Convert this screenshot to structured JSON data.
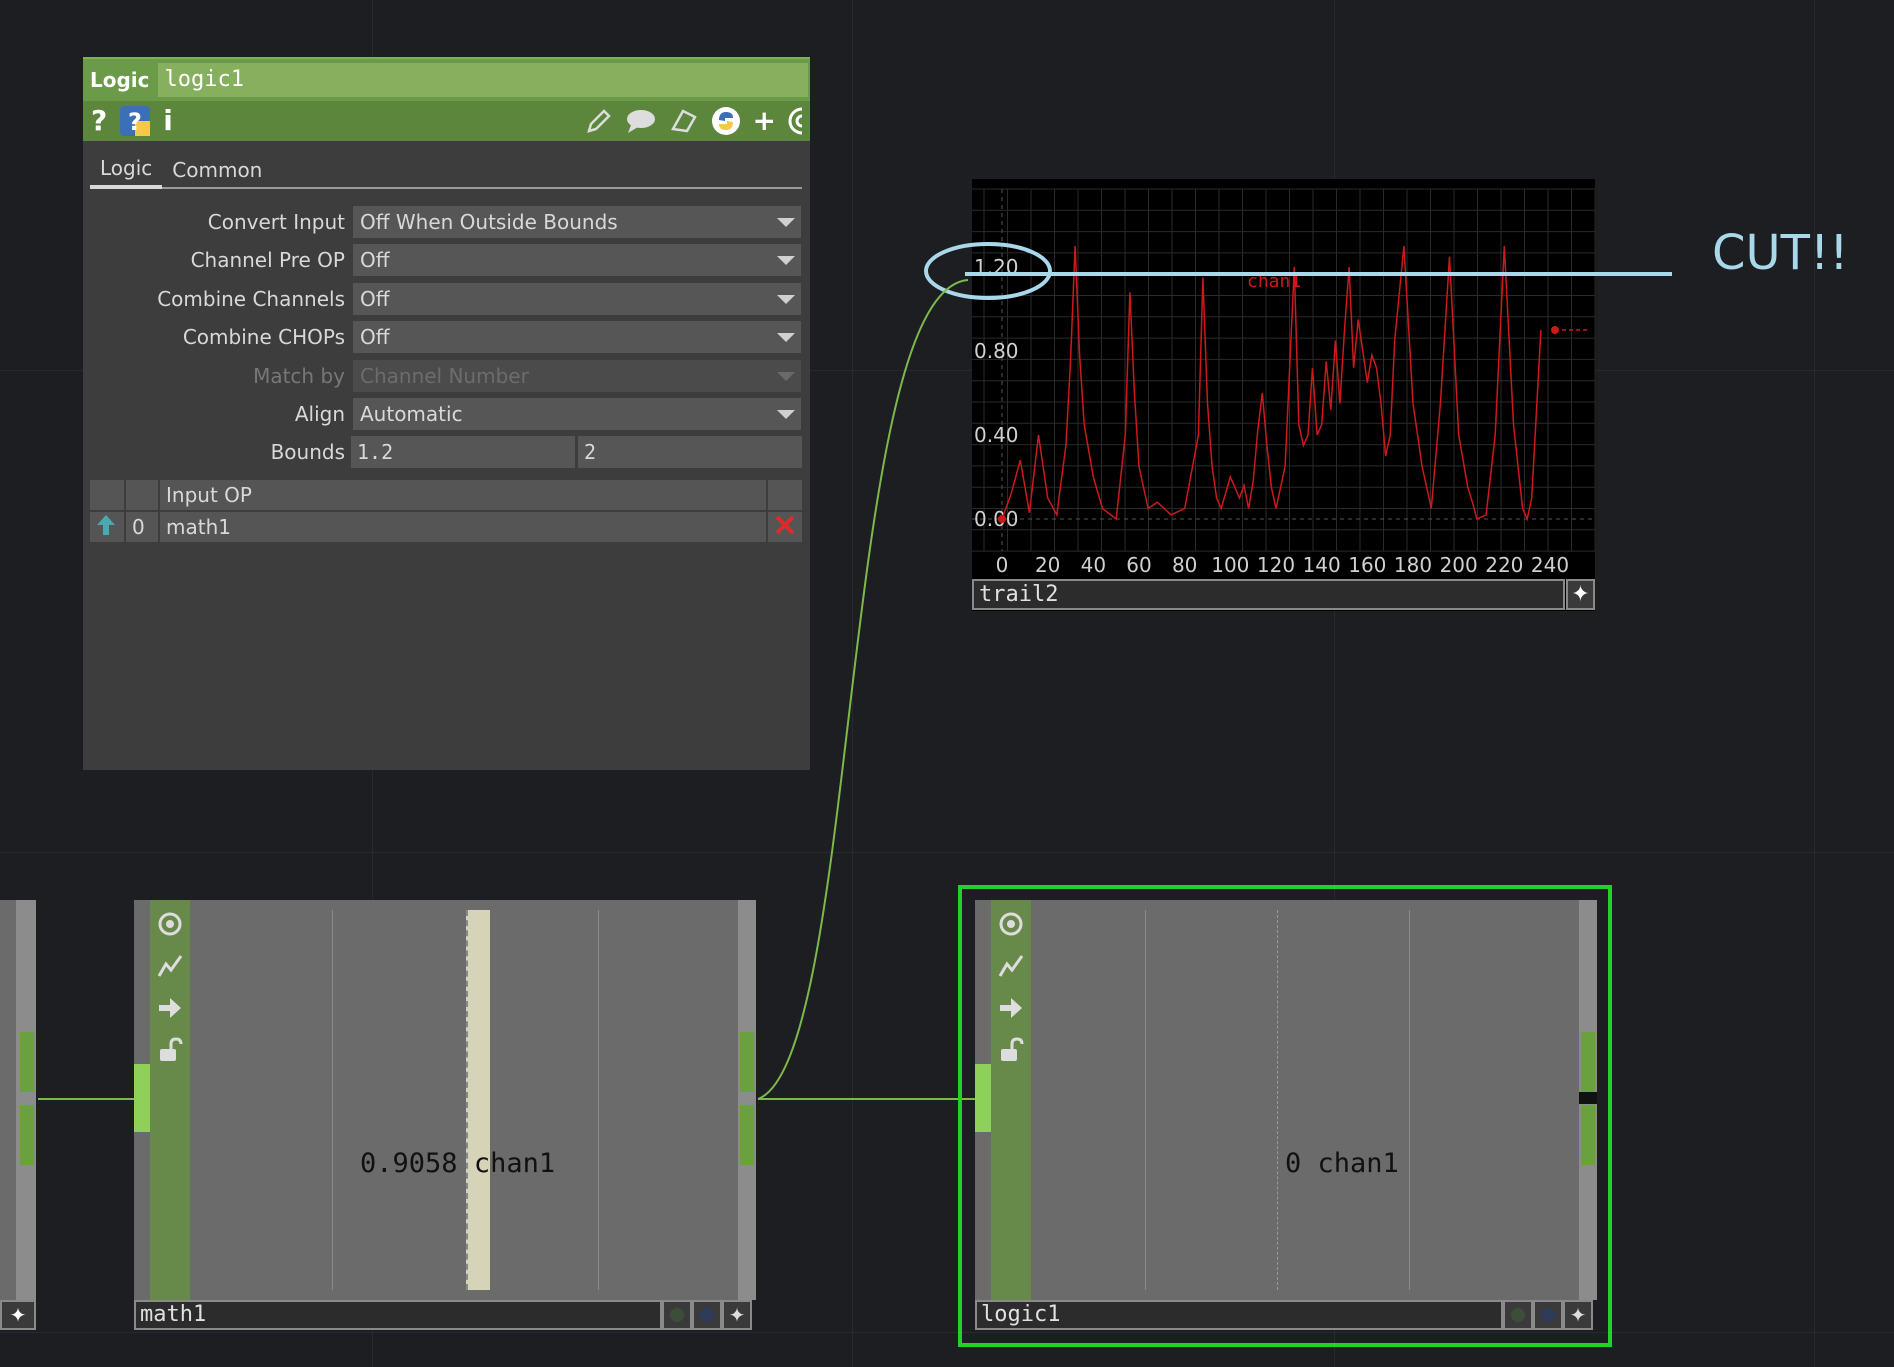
{
  "panel": {
    "op_type": "Logic",
    "op_name": "logic1",
    "tabs": [
      "Logic",
      "Common"
    ],
    "params": [
      {
        "label": "Convert Input",
        "value": "Off When Outside Bounds"
      },
      {
        "label": "Channel Pre OP",
        "value": "Off"
      },
      {
        "label": "Combine Channels",
        "value": "Off"
      },
      {
        "label": "Combine CHOPs",
        "value": "Off"
      },
      {
        "label": "Match by",
        "value": "Channel Number"
      },
      {
        "label": "Align",
        "value": "Automatic"
      }
    ],
    "bounds": {
      "label": "Bounds",
      "low": "1.2",
      "high": "2"
    },
    "inputs_header": "Input OP",
    "inputs": [
      {
        "index": "0",
        "op": "math1"
      }
    ]
  },
  "viewer": {
    "name": "trail2",
    "plus": "✦",
    "chart_data": {
      "type": "line",
      "series": [
        {
          "name": "chan1",
          "color": "#cc1a1a"
        }
      ],
      "yticks": [
        "1.20",
        "0.80",
        "0.40",
        "0.00"
      ],
      "xticks": [
        "0",
        "20",
        "40",
        "60",
        "80",
        "100",
        "120",
        "140",
        "160",
        "180",
        "200",
        "220",
        "240"
      ],
      "ylim": [
        0,
        1.2
      ],
      "xlim": [
        0,
        240
      ],
      "x": [
        0,
        4,
        8,
        12,
        16,
        20,
        24,
        28,
        30,
        32,
        34,
        36,
        40,
        44,
        50,
        54,
        56,
        58,
        60,
        64,
        68,
        74,
        80,
        86,
        88,
        90,
        92,
        94,
        96,
        100,
        104,
        106,
        108,
        110,
        112,
        114,
        116,
        118,
        120,
        124,
        128,
        130,
        132,
        134,
        136,
        138,
        140,
        142,
        144,
        146,
        148,
        150,
        152,
        154,
        156,
        158,
        160,
        162,
        164,
        166,
        168,
        170,
        172,
        176,
        180,
        184,
        188,
        192,
        196,
        200,
        204,
        206,
        208,
        212,
        216,
        220,
        224,
        228,
        230,
        232,
        236
      ],
      "y": [
        0,
        0.12,
        0.28,
        0.03,
        0.4,
        0.1,
        0.02,
        0.35,
        0.75,
        1.3,
        0.78,
        0.45,
        0.2,
        0.05,
        0,
        0.4,
        1.08,
        0.6,
        0.25,
        0.05,
        0.08,
        0.02,
        0.05,
        0.4,
        1.15,
        0.55,
        0.25,
        0.1,
        0.05,
        0.2,
        0.1,
        0.16,
        0.05,
        0.18,
        0.42,
        0.6,
        0.35,
        0.15,
        0.05,
        0.25,
        1.2,
        0.45,
        0.35,
        0.4,
        0.72,
        0.4,
        0.45,
        0.75,
        0.52,
        0.85,
        0.55,
        0.9,
        1.2,
        0.72,
        0.95,
        0.8,
        0.65,
        0.78,
        0.72,
        0.55,
        0.3,
        0.4,
        0.85,
        1.3,
        0.55,
        0.25,
        0.05,
        0.55,
        1.25,
        0.4,
        0.15,
        0.08,
        0.0,
        0.02,
        0.4,
        1.3,
        0.45,
        0.05,
        0.0,
        0.1,
        0.9
      ],
      "current_value": 0.9
    }
  },
  "annotation": "CUT!!",
  "nodes": {
    "math1": {
      "name": "math1",
      "value": "0.9058",
      "channel": "chan1"
    },
    "logic1": {
      "name": "logic1",
      "value": "0",
      "channel": "chan1"
    }
  },
  "colors": {
    "op_green": "#6b9a48",
    "selected": "#22d22a",
    "curve": "#cc1a1a",
    "annotation": "#a9d8ea"
  }
}
